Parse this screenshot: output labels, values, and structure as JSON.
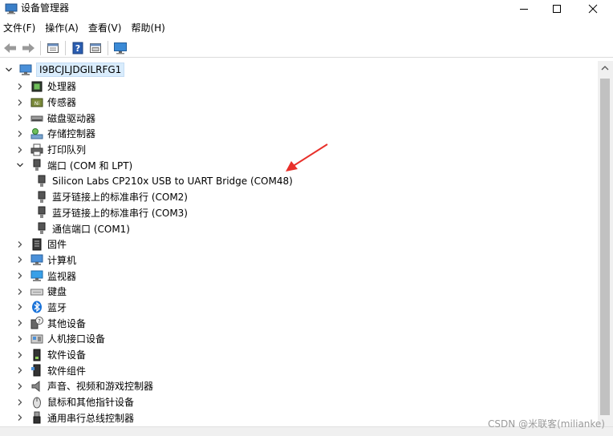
{
  "window": {
    "title": "设备管理器"
  },
  "menubar": {
    "items": [
      {
        "label": "文件(F)"
      },
      {
        "label": "操作(A)"
      },
      {
        "label": "查看(V)"
      },
      {
        "label": "帮助(H)"
      }
    ]
  },
  "toolbar": {
    "buttons": [
      "back-icon",
      "forward-icon",
      "properties-icon",
      "help-icon",
      "update-driver-icon",
      "monitor-icon"
    ]
  },
  "tree": {
    "root": {
      "label": "I9BCJLJDGILRFG1",
      "expanded": true
    },
    "categories": [
      {
        "label": "处理器",
        "icon": "processor-icon",
        "expanded": false
      },
      {
        "label": "传感器",
        "icon": "sensor-icon",
        "expanded": false
      },
      {
        "label": "磁盘驱动器",
        "icon": "disk-icon",
        "expanded": false
      },
      {
        "label": "存储控制器",
        "icon": "storage-icon",
        "expanded": false
      },
      {
        "label": "打印队列",
        "icon": "printer-icon",
        "expanded": false
      },
      {
        "label": "端口 (COM 和 LPT)",
        "icon": "port-icon",
        "expanded": true,
        "children": [
          {
            "label": "Silicon Labs CP210x USB to UART Bridge (COM48)"
          },
          {
            "label": "蓝牙链接上的标准串行 (COM2)"
          },
          {
            "label": "蓝牙链接上的标准串行 (COM3)"
          },
          {
            "label": "通信端口 (COM1)"
          }
        ]
      },
      {
        "label": "固件",
        "icon": "firmware-icon",
        "expanded": false
      },
      {
        "label": "计算机",
        "icon": "computer-icon",
        "expanded": false
      },
      {
        "label": "监视器",
        "icon": "monitor-icon",
        "expanded": false
      },
      {
        "label": "键盘",
        "icon": "keyboard-icon",
        "expanded": false
      },
      {
        "label": "蓝牙",
        "icon": "bluetooth-icon",
        "expanded": false
      },
      {
        "label": "其他设备",
        "icon": "other-device-icon",
        "expanded": false
      },
      {
        "label": "人机接口设备",
        "icon": "hid-icon",
        "expanded": false
      },
      {
        "label": "软件设备",
        "icon": "software-device-icon",
        "expanded": false
      },
      {
        "label": "软件组件",
        "icon": "software-component-icon",
        "expanded": false
      },
      {
        "label": "声音、视频和游戏控制器",
        "icon": "speaker-icon",
        "expanded": false
      },
      {
        "label": "鼠标和其他指针设备",
        "icon": "mouse-icon",
        "expanded": false
      },
      {
        "label": "通用串行总线控制器",
        "icon": "usb-icon",
        "expanded": false
      }
    ]
  },
  "annotation": {
    "arrow_color": "#e8302a"
  },
  "watermark": "CSDN @米联客(milianke)"
}
